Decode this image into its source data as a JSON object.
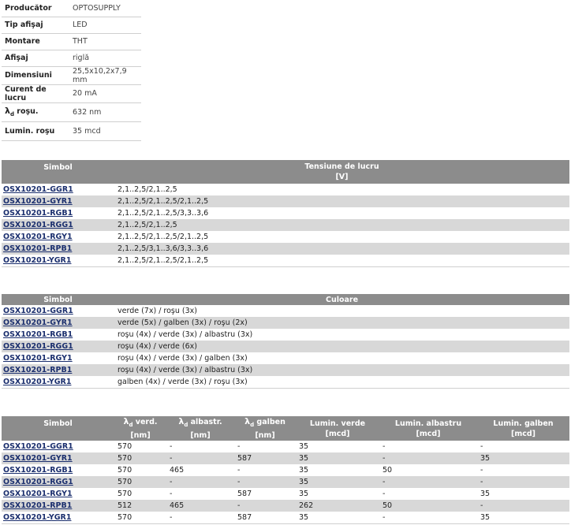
{
  "specs": [
    {
      "label": "Producător",
      "value": "OPTOSUPPLY"
    },
    {
      "label": "Tip afişaj",
      "value": "LED"
    },
    {
      "label": "Montare",
      "value": "THT"
    },
    {
      "label": "Afişaj",
      "value": "riglă"
    },
    {
      "label": "Dimensiuni",
      "value": "25,5x10,2x7,9 mm"
    },
    {
      "label": "Curent de lucru",
      "value": "20 mA"
    },
    {
      "label": "roşu.",
      "value": "632 nm"
    },
    {
      "label": "Lumin. roşu",
      "value": "35 mcd"
    }
  ],
  "lambda": {
    "symbol": "λ",
    "sub": "d"
  },
  "table1": {
    "headers": {
      "simbol": "Simbol",
      "tensiune": "Tensiune de lucru",
      "tensiune_unit": "[V]"
    },
    "rows": [
      {
        "sym": "OSX10201-GGR1",
        "val": "2,1..2,5/2,1..2,5"
      },
      {
        "sym": "OSX10201-GYR1",
        "val": "2,1..2,5/2,1..2,5/2,1..2,5"
      },
      {
        "sym": "OSX10201-RGB1",
        "val": "2,1..2,5/2,1..2,5/3,3..3,6"
      },
      {
        "sym": "OSX10201-RGG1",
        "val": "2,1..2,5/2,1..2,5"
      },
      {
        "sym": "OSX10201-RGY1",
        "val": "2,1..2,5/2,1..2,5/2,1..2,5"
      },
      {
        "sym": "OSX10201-RPB1",
        "val": "2,1..2,5/3,1..3,6/3,3..3,6"
      },
      {
        "sym": "OSX10201-YGR1",
        "val": "2,1..2,5/2,1..2,5/2,1..2,5"
      }
    ]
  },
  "table2": {
    "headers": {
      "simbol": "Simbol",
      "culoare": "Culoare"
    },
    "rows": [
      {
        "sym": "OSX10201-GGR1",
        "val": "verde (7x) / roşu (3x)"
      },
      {
        "sym": "OSX10201-GYR1",
        "val": "verde (5x) / galben (3x) / roşu (2x)"
      },
      {
        "sym": "OSX10201-RGB1",
        "val": "roşu (4x) / verde (3x) / albastru (3x)"
      },
      {
        "sym": "OSX10201-RGG1",
        "val": "roşu (4x) / verde (6x)"
      },
      {
        "sym": "OSX10201-RGY1",
        "val": "roşu (4x) / verde (3x) / galben (3x)"
      },
      {
        "sym": "OSX10201-RPB1",
        "val": "roşu (4x) / verde (3x) / albastru (3x)"
      },
      {
        "sym": "OSX10201-YGR1",
        "val": "galben (4x) / verde (3x) / roşu (3x)"
      }
    ]
  },
  "table3": {
    "headers": {
      "simbol": "Simbol",
      "verd": "verd.",
      "verd_unit": "[nm]",
      "albastr": "albastr.",
      "albastr_unit": "[nm]",
      "galben": "galben",
      "galben_unit": "[nm]",
      "lumin_verde": "Lumin. verde",
      "lumin_verde_unit": "[mcd]",
      "lumin_albastru": "Lumin. albastru",
      "lumin_albastru_unit": "[mcd]",
      "lumin_galben": "Lumin. galben",
      "lumin_galben_unit": "[mcd]"
    },
    "rows": [
      {
        "sym": "OSX10201-GGR1",
        "c": [
          "570",
          "-",
          "-",
          "35",
          "-",
          "-"
        ]
      },
      {
        "sym": "OSX10201-GYR1",
        "c": [
          "570",
          "-",
          "587",
          "35",
          "-",
          "35"
        ]
      },
      {
        "sym": "OSX10201-RGB1",
        "c": [
          "570",
          "465",
          "-",
          "35",
          "50",
          "-"
        ]
      },
      {
        "sym": "OSX10201-RGG1",
        "c": [
          "570",
          "-",
          "-",
          "35",
          "-",
          "-"
        ]
      },
      {
        "sym": "OSX10201-RGY1",
        "c": [
          "570",
          "-",
          "587",
          "35",
          "-",
          "35"
        ]
      },
      {
        "sym": "OSX10201-RPB1",
        "c": [
          "512",
          "465",
          "-",
          "262",
          "50",
          "-"
        ]
      },
      {
        "sym": "OSX10201-YGR1",
        "c": [
          "570",
          "-",
          "587",
          "35",
          "-",
          "35"
        ]
      }
    ]
  }
}
